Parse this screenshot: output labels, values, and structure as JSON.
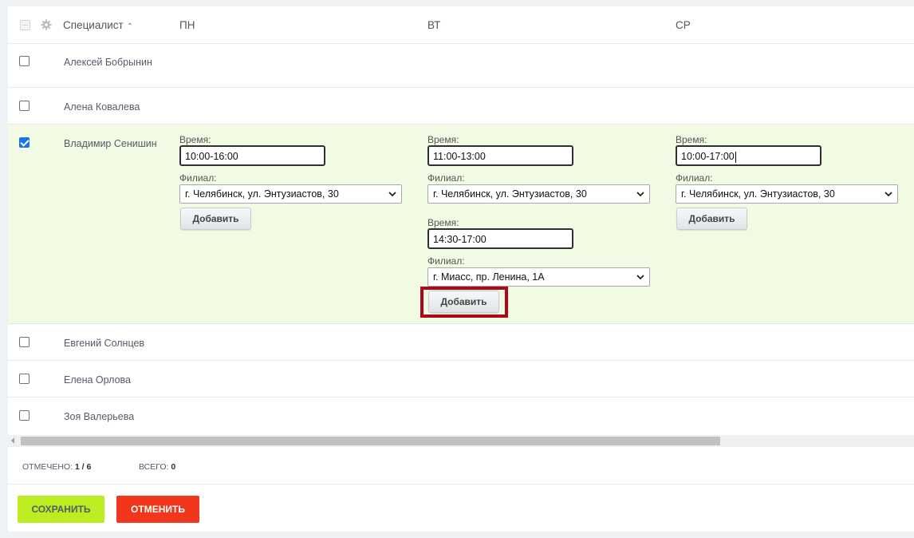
{
  "header": {
    "specialist_label": "Специалист",
    "day_mon": "ПН",
    "day_tue": "ВТ",
    "day_wed": "СР"
  },
  "rows": [
    {
      "name": "Алексей Бобрынин",
      "checked": false
    },
    {
      "name": "Алена Ковалева",
      "checked": false
    },
    {
      "name": "Владимир Сенишин",
      "checked": true
    },
    {
      "name": "Евгений Солнцев",
      "checked": false
    },
    {
      "name": "Елена Орлова",
      "checked": false
    },
    {
      "name": "Зоя Валерьева",
      "checked": false
    }
  ],
  "editor": {
    "time_label": "Время:",
    "branch_label": "Филиал:",
    "add_label": "Добавить",
    "mon": [
      {
        "time": "10:00-16:00",
        "branch": "г. Челябинск, ул. Энтузиастов, 30"
      }
    ],
    "tue": [
      {
        "time": "11:00-13:00",
        "branch": "г. Челябинск, ул. Энтузиастов, 30"
      },
      {
        "time": "14:30-17:00",
        "branch": "г. Миасс, пр. Ленина, 1А"
      }
    ],
    "wed": [
      {
        "time": "10:00-17:00",
        "branch": "г. Челябинск, ул. Энтузиастов, 30"
      }
    ]
  },
  "footer": {
    "checked_label": "Отмечено:",
    "checked_value": "1 / 6",
    "total_label": "Всего:",
    "total_value": "0",
    "save_label": "СОХРАНИТЬ",
    "cancel_label": "ОТМЕНИТЬ"
  },
  "colors": {
    "selected_row": "#f1fae3",
    "save_button": "#bbed21",
    "cancel_button": "#f1361b",
    "highlight": "#b0061a",
    "checkbox_checked": "#1a73e8"
  },
  "icons": {
    "settings": "gear-icon",
    "sort": "caret-up-icon",
    "select": "chevron-down-icon"
  }
}
